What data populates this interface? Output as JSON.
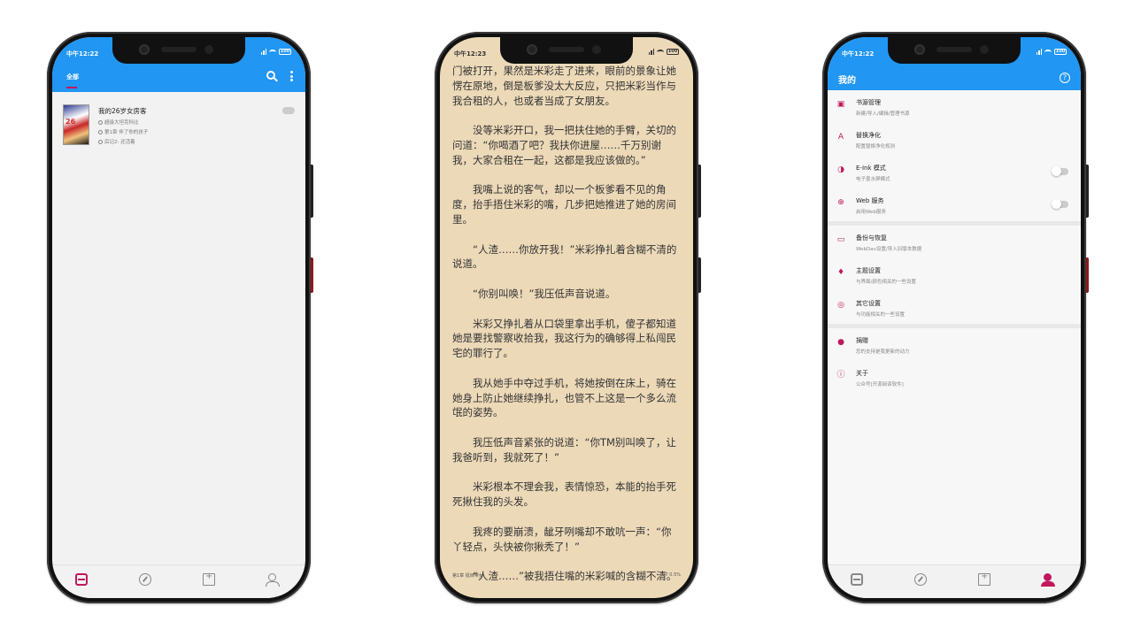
{
  "theme": {
    "primary": "#2196f3",
    "accent": "#c2185b",
    "reader_bg": "#ecd9b8"
  },
  "status_bars": [
    {
      "time": "中午12:22",
      "battery": "100"
    },
    {
      "time": "中午12:23",
      "battery": "100"
    },
    {
      "time": "中午12:22",
      "battery": "100"
    }
  ],
  "bookshelf": {
    "tab_label": "全部",
    "books": [
      {
        "title": "我的26岁女房客",
        "cover_text": "26",
        "author": "超级大坦克科比",
        "latest": "第1章 伴了你的孩子",
        "read": "后记2: 还活着"
      }
    ],
    "bottom_nav": [
      "bookshelf-icon",
      "compass-icon",
      "bookmark-icon",
      "person-icon"
    ]
  },
  "reader": {
    "paragraphs": [
      "门被打开，果然是米彩走了进来，眼前的景象让她愣在原地，倒是板爹没太大反应，只把米彩当作与我合租的人，也或者当成了女朋友。",
      "没等米彩开口，我一把扶住她的手臂，关切的问道：“你喝酒了吧？我扶你进屋……千万别谢我，大家合租在一起，这都是我应该做的。”",
      "我嘴上说的客气，却以一个板爹看不见的角度，抬手捂住米彩的嘴，几步把她推进了她的房间里。",
      "“人渣……你放开我！”米彩挣扎着含糊不清的说道。",
      "“你别叫唤！”我压低声音说道。",
      "米彩又挣扎着从口袋里拿出手机，傻子都知道她是要找警察收拾我，我这行为的确够得上私闯民宅的罪行了。",
      "我从她手中夺过手机，将她按倒在床上，骑在她身上防止她继续挣扎，也管不上这是一个多么流氓的姿势。",
      "我压低声音紧张的说道：“你TM别叫唤了，让我爸听到，我就死了！”",
      "米彩根本不理会我，表情惊恐，本能的抬手死死揪住我的头发。",
      "我疼的要崩溃，龇牙咧嘴却不敢吭一声：“你丫轻点，头快被你揪秃了！”",
      "“人渣……”被我捂住嘴的米彩喊的含糊不清。"
    ],
    "footer_chapter": "第1章 挺目带女",
    "footer_progress": "3/7  0.5%"
  },
  "mine": {
    "title": "我的",
    "help": "?",
    "groups": [
      [
        {
          "icon": "book-source-icon",
          "glyph": "▣",
          "label": "书源管理",
          "sub": "新建/导入/编辑/管理书源"
        },
        {
          "icon": "replace-icon",
          "glyph": "A",
          "label": "替换净化",
          "sub": "配置替换净化规则"
        },
        {
          "icon": "eink-icon",
          "glyph": "◑",
          "label": "E-Ink 模式",
          "sub": "电子墨水屏模式",
          "toggle": true
        },
        {
          "icon": "web-icon",
          "glyph": "⊕",
          "label": "Web 服务",
          "sub": "启用Web服务",
          "toggle": true
        }
      ],
      [
        {
          "icon": "folder-icon",
          "glyph": "▭",
          "label": "备份与恢复",
          "sub": "WebDav设置/导入旧版本数据"
        },
        {
          "icon": "theme-icon",
          "glyph": "♦",
          "label": "主题设置",
          "sub": "与界面/颜色相关的一些设置"
        },
        {
          "icon": "settings-icon",
          "glyph": "◎",
          "label": "其它设置",
          "sub": "与功能相关的一些设置"
        }
      ],
      [
        {
          "icon": "donate-icon",
          "glyph": "●",
          "label": "捐赠",
          "sub": "您的支持是我更新的动力"
        },
        {
          "icon": "info-icon",
          "glyph": "ⓘ",
          "label": "关于",
          "sub": "公众号[开源阅读软件]"
        }
      ]
    ]
  }
}
